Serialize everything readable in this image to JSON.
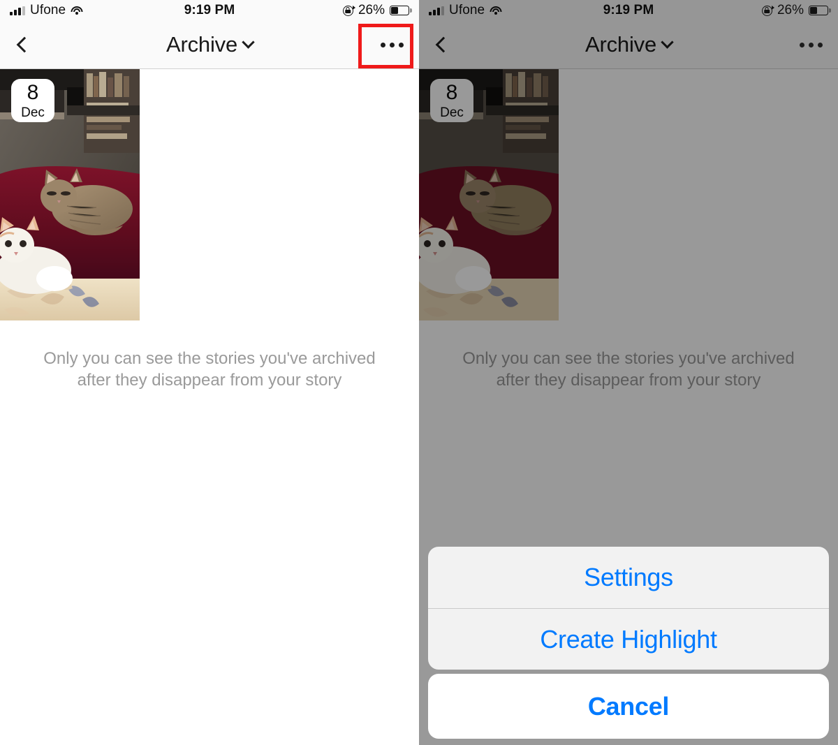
{
  "status_bar": {
    "carrier": "Ufone",
    "time": "9:19 PM",
    "battery_percent": "26%",
    "battery_level": 26,
    "signal_bars_filled": 3,
    "signal_bars_total": 4,
    "icons": [
      "signal-bars-icon",
      "wifi-icon",
      "rotation-lock-icon",
      "battery-icon"
    ]
  },
  "nav_bar": {
    "back_icon": "chevron-left-icon",
    "title": "Archive",
    "title_chevron_icon": "chevron-down-icon",
    "more_icon": "ellipsis-icon"
  },
  "content": {
    "story": {
      "day": "8",
      "month": "Dec",
      "thumbnail_alt": "two-cats-on-red-blanket"
    },
    "caption_line1": "Only you can see the stories you've archived",
    "caption_line2": "after they disappear from your story"
  },
  "action_sheet": {
    "items": [
      {
        "label": "Settings"
      },
      {
        "label": "Create Highlight"
      }
    ],
    "cancel_label": "Cancel"
  },
  "annotation": {
    "highlight_color": "#ef1a1a",
    "highlight_target": "more-options-button"
  },
  "colors": {
    "accent_blue": "#007aff",
    "navbar_background": "#fafafa",
    "caption_text": "#9a9a9a",
    "sheet_background": "#f2f2f2",
    "cancel_background": "#ffffff",
    "dim_overlay": "rgba(0,0,0,0.40)"
  }
}
